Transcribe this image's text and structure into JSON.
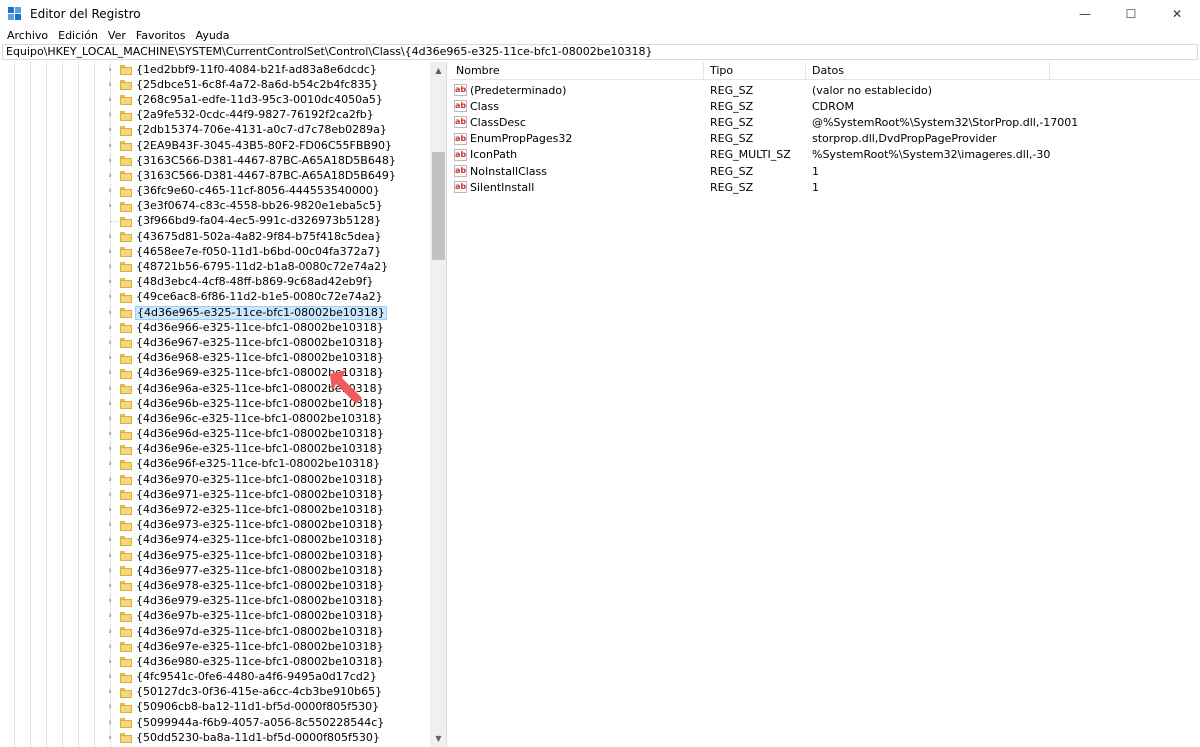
{
  "window": {
    "title": "Editor del Registro",
    "minimize": "—",
    "maximize": "☐",
    "close": "✕"
  },
  "menu": [
    "Archivo",
    "Edición",
    "Ver",
    "Favoritos",
    "Ayuda"
  ],
  "address": "Equipo\\HKEY_LOCAL_MACHINE\\SYSTEM\\CurrentControlSet\\Control\\Class\\{4d36e965-e325-11ce-bfc1-08002be10318}",
  "tree": {
    "selected_index": 16,
    "items": [
      "{1ed2bbf9-11f0-4084-b21f-ad83a8e6dcdc}",
      "{25dbce51-6c8f-4a72-8a6d-b54c2b4fc835}",
      "{268c95a1-edfe-11d3-95c3-0010dc4050a5}",
      "{2a9fe532-0cdc-44f9-9827-76192f2ca2fb}",
      "{2db15374-706e-4131-a0c7-d7c78eb0289a}",
      "{2EA9B43F-3045-43B5-80F2-FD06C55FBB90}",
      "{3163C566-D381-4467-87BC-A65A18D5B648}",
      "{3163C566-D381-4467-87BC-A65A18D5B649}",
      "{36fc9e60-c465-11cf-8056-444553540000}",
      "{3e3f0674-c83c-4558-bb26-9820e1eba5c5}",
      "{3f966bd9-fa04-4ec5-991c-d326973b5128}",
      "{43675d81-502a-4a82-9f84-b75f418c5dea}",
      "{4658ee7e-f050-11d1-b6bd-00c04fa372a7}",
      "{48721b56-6795-11d2-b1a8-0080c72e74a2}",
      "{48d3ebc4-4cf8-48ff-b869-9c68ad42eb9f}",
      "{49ce6ac8-6f86-11d2-b1e5-0080c72e74a2}",
      "{4d36e965-e325-11ce-bfc1-08002be10318}",
      "{4d36e966-e325-11ce-bfc1-08002be10318}",
      "{4d36e967-e325-11ce-bfc1-08002be10318}",
      "{4d36e968-e325-11ce-bfc1-08002be10318}",
      "{4d36e969-e325-11ce-bfc1-08002be10318}",
      "{4d36e96a-e325-11ce-bfc1-08002be10318}",
      "{4d36e96b-e325-11ce-bfc1-08002be10318}",
      "{4d36e96c-e325-11ce-bfc1-08002be10318}",
      "{4d36e96d-e325-11ce-bfc1-08002be10318}",
      "{4d36e96e-e325-11ce-bfc1-08002be10318}",
      "{4d36e96f-e325-11ce-bfc1-08002be10318}",
      "{4d36e970-e325-11ce-bfc1-08002be10318}",
      "{4d36e971-e325-11ce-bfc1-08002be10318}",
      "{4d36e972-e325-11ce-bfc1-08002be10318}",
      "{4d36e973-e325-11ce-bfc1-08002be10318}",
      "{4d36e974-e325-11ce-bfc1-08002be10318}",
      "{4d36e975-e325-11ce-bfc1-08002be10318}",
      "{4d36e977-e325-11ce-bfc1-08002be10318}",
      "{4d36e978-e325-11ce-bfc1-08002be10318}",
      "{4d36e979-e325-11ce-bfc1-08002be10318}",
      "{4d36e97b-e325-11ce-bfc1-08002be10318}",
      "{4d36e97d-e325-11ce-bfc1-08002be10318}",
      "{4d36e97e-e325-11ce-bfc1-08002be10318}",
      "{4d36e980-e325-11ce-bfc1-08002be10318}",
      "{4fc9541c-0fe6-4480-a4f6-9495a0d17cd2}",
      "{50127dc3-0f36-415e-a6cc-4cb3be910b65}",
      "{50906cb8-ba12-11d1-bf5d-0000f805f530}",
      "{5099944a-f6b9-4057-a056-8c550228544c}",
      "{50dd5230-ba8a-11d1-bf5d-0000f805f530}"
    ],
    "no_expander_index": 10
  },
  "values": {
    "headers": {
      "name": "Nombre",
      "type": "Tipo",
      "data": "Datos"
    },
    "rows": [
      {
        "name": "(Predeterminado)",
        "type": "REG_SZ",
        "data": "(valor no establecido)"
      },
      {
        "name": "Class",
        "type": "REG_SZ",
        "data": "CDROM"
      },
      {
        "name": "ClassDesc",
        "type": "REG_SZ",
        "data": "@%SystemRoot%\\System32\\StorProp.dll,-17001"
      },
      {
        "name": "EnumPropPages32",
        "type": "REG_SZ",
        "data": "storprop.dll,DvdPropPageProvider"
      },
      {
        "name": "IconPath",
        "type": "REG_MULTI_SZ",
        "data": "%SystemRoot%\\System32\\imageres.dll,-30"
      },
      {
        "name": "NoInstallClass",
        "type": "REG_SZ",
        "data": "1"
      },
      {
        "name": "SilentInstall",
        "type": "REG_SZ",
        "data": "1"
      }
    ],
    "icon_text": "ab"
  },
  "colors": {
    "selection_bg": "#cce8ff",
    "selection_border": "#99d1ff",
    "callout_arrow": "#f05a5a",
    "folder": "#f6d77a"
  }
}
